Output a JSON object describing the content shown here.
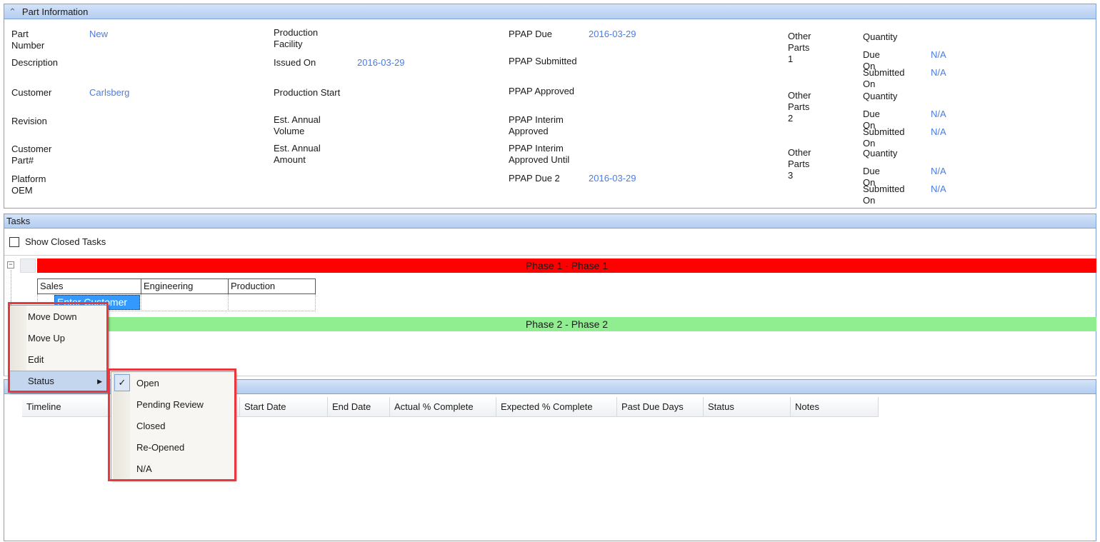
{
  "part_info": {
    "title": "Part Information",
    "col1": [
      {
        "label": "Part Number",
        "value": "New"
      },
      {
        "label": "Description",
        "value": ""
      },
      {
        "label": "Customer",
        "value": "Carlsberg"
      },
      {
        "label": "Revision",
        "value": ""
      },
      {
        "label": "Customer Part#",
        "value": ""
      },
      {
        "label": "Platform OEM",
        "value": ""
      }
    ],
    "col2": [
      {
        "label": "Production Facility",
        "value": ""
      },
      {
        "label": "Issued On",
        "value": "2016-03-29"
      },
      {
        "label": "Production Start",
        "value": ""
      },
      {
        "label": "Est. Annual Volume",
        "value": ""
      },
      {
        "label": "Est. Annual Amount",
        "value": ""
      }
    ],
    "col3": [
      {
        "label": "PPAP Due",
        "value": "2016-03-29"
      },
      {
        "label": "PPAP Submitted",
        "value": ""
      },
      {
        "label": "PPAP Approved",
        "value": ""
      },
      {
        "label": "PPAP Interim Approved",
        "value": ""
      },
      {
        "label": "PPAP Interim Approved Until",
        "value": ""
      },
      {
        "label": "PPAP Due 2",
        "value": "2016-03-29"
      }
    ],
    "other_parts": [
      {
        "label": "Other Parts 1",
        "quantity_label": "Quantity",
        "due_label": "Due On",
        "due": "N/A",
        "submitted_label": "Submitted On",
        "submitted": "N/A"
      },
      {
        "label": "Other Parts 2",
        "quantity_label": "Quantity",
        "due_label": "Due On",
        "due": "N/A",
        "submitted_label": "Submitted On",
        "submitted": "N/A"
      },
      {
        "label": "Other Parts 3",
        "quantity_label": "Quantity",
        "due_label": "Due On",
        "due": "N/A",
        "submitted_label": "Submitted On",
        "submitted": "N/A"
      }
    ]
  },
  "tasks": {
    "title": "Tasks",
    "show_closed": "Show Closed Tasks",
    "phase1": {
      "label": "Phase 1 - Phase 1",
      "color": "#ff0000"
    },
    "phase2": {
      "label": "Phase 2 - Phase 2",
      "color": "#90ee90"
    },
    "columns": [
      "Sales",
      "Engineering",
      "Production"
    ],
    "selected_cell": "Enter Customer"
  },
  "timeline": {
    "columns": [
      "Timeline",
      "Start Date",
      "End Date",
      "Actual % Complete",
      "Expected % Complete",
      "Past Due Days",
      "Status",
      "Notes"
    ]
  },
  "context_menu": {
    "items": [
      "Move Down",
      "Move Up",
      "Edit",
      "Status"
    ]
  },
  "status_menu": {
    "items": [
      "Open",
      "Pending Review",
      "Closed",
      "Re-Opened",
      "N/A"
    ],
    "checked": "Open"
  },
  "colors": {
    "link": "#4a7be6",
    "highlight": "#3399ff",
    "annotation": "#e8383f"
  }
}
